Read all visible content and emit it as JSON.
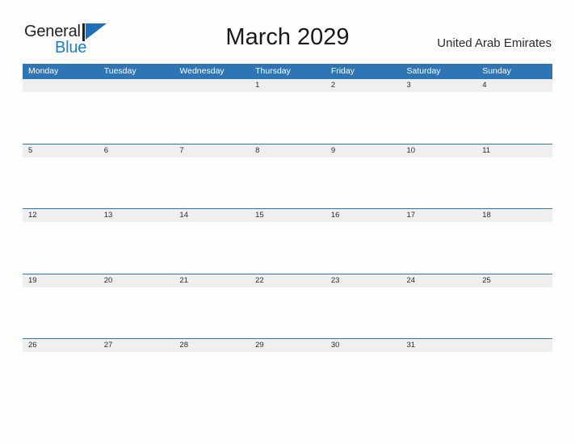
{
  "brand": {
    "name_part1": "General",
    "name_part2": "Blue",
    "flag_icon": "flag-triangle-icon",
    "accent_color": "#1e6fb8"
  },
  "header": {
    "title": "March 2029",
    "region": "United Arab Emirates"
  },
  "calendar": {
    "month": "March",
    "year": "2029",
    "header_bg": "#2e75b6",
    "band_bg": "#efefef",
    "weekday_headers": [
      "Monday",
      "Tuesday",
      "Wednesday",
      "Thursday",
      "Friday",
      "Saturday",
      "Sunday"
    ],
    "weeks": [
      {
        "days": [
          "",
          "",
          "",
          "1",
          "2",
          "3",
          "4"
        ]
      },
      {
        "days": [
          "5",
          "6",
          "7",
          "8",
          "9",
          "10",
          "11"
        ]
      },
      {
        "days": [
          "12",
          "13",
          "14",
          "15",
          "16",
          "17",
          "18"
        ]
      },
      {
        "days": [
          "19",
          "20",
          "21",
          "22",
          "23",
          "24",
          "25"
        ]
      },
      {
        "days": [
          "26",
          "27",
          "28",
          "29",
          "30",
          "31",
          ""
        ]
      }
    ]
  }
}
